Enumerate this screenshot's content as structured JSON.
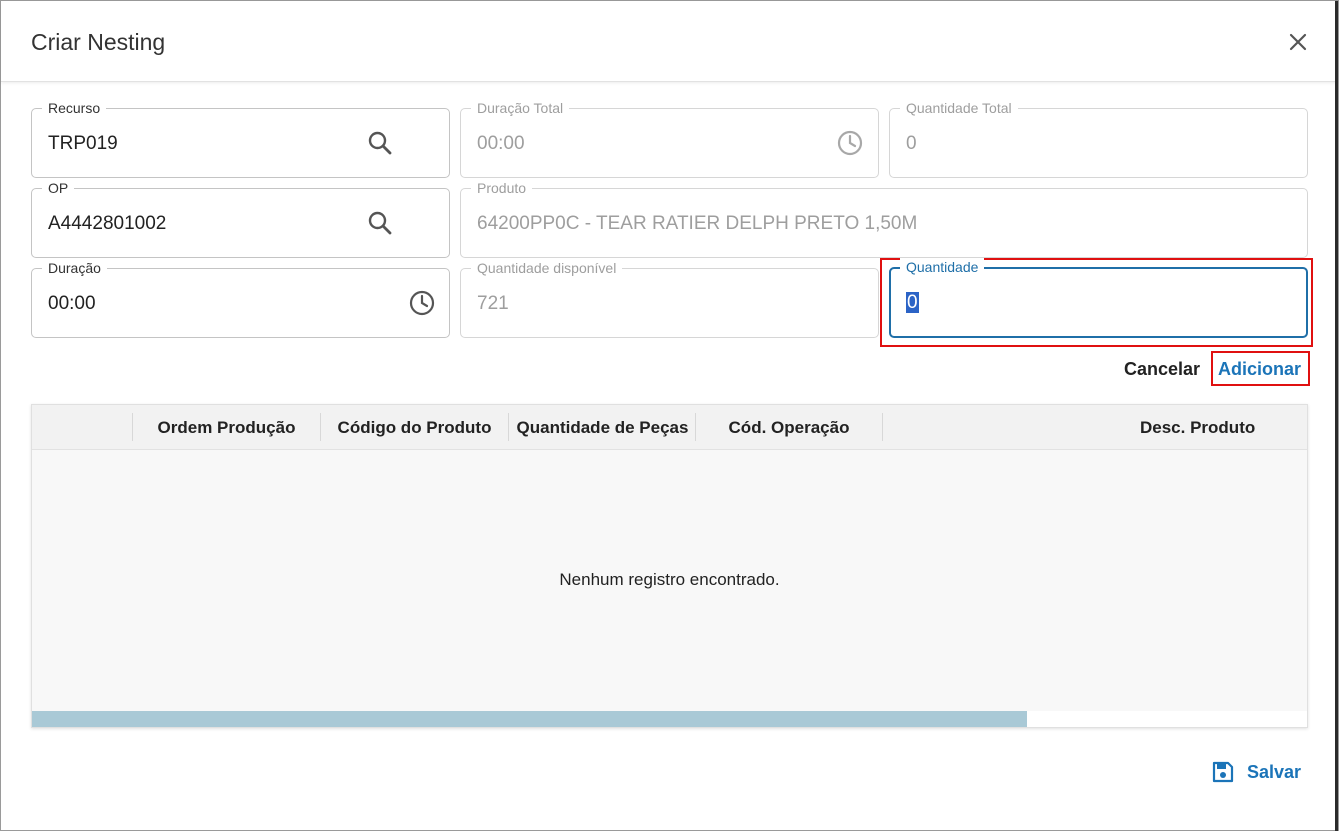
{
  "dialog": {
    "title": "Criar Nesting",
    "close_icon": "close-icon"
  },
  "fields": {
    "recurso": {
      "label": "Recurso",
      "value": "TRP019",
      "icon": "search-icon"
    },
    "duracao_total": {
      "label": "Duração Total",
      "value": "00:00",
      "icon": "clock-icon",
      "disabled": true
    },
    "quantidade_total": {
      "label": "Quantidade Total",
      "value": "0",
      "disabled": true
    },
    "op": {
      "label": "OP",
      "value": "A4442801002",
      "icon": "search-icon"
    },
    "produto": {
      "label": "Produto",
      "value": "64200PP0C - TEAR RATIER DELPH PRETO 1,50M",
      "disabled": true
    },
    "duracao": {
      "label": "Duração",
      "value": "00:00",
      "icon": "clock-icon"
    },
    "quantidade_disponivel": {
      "label": "Quantidade disponível",
      "value": "721",
      "disabled": true
    },
    "quantidade": {
      "label": "Quantidade",
      "value": "0",
      "focused": true
    }
  },
  "actions": {
    "cancel_label": "Cancelar",
    "add_label": "Adicionar"
  },
  "table": {
    "columns": [
      "",
      "Ordem Produção",
      "Código do Produto",
      "Quantidade de Peças",
      "Cód. Operação",
      "Desc. Produto"
    ],
    "rows": [],
    "empty_message": "Nenhum registro encontrado.",
    "horizontal_scroll_fraction": 0.78
  },
  "footer": {
    "save_label": "Salvar",
    "save_icon": "floppy-disk-icon"
  },
  "colors": {
    "accent": "#1b74b8",
    "focus_border": "#1f6fa8",
    "highlight_annotation": "#e01010",
    "scrollbar_thumb": "#a9c9d6"
  }
}
